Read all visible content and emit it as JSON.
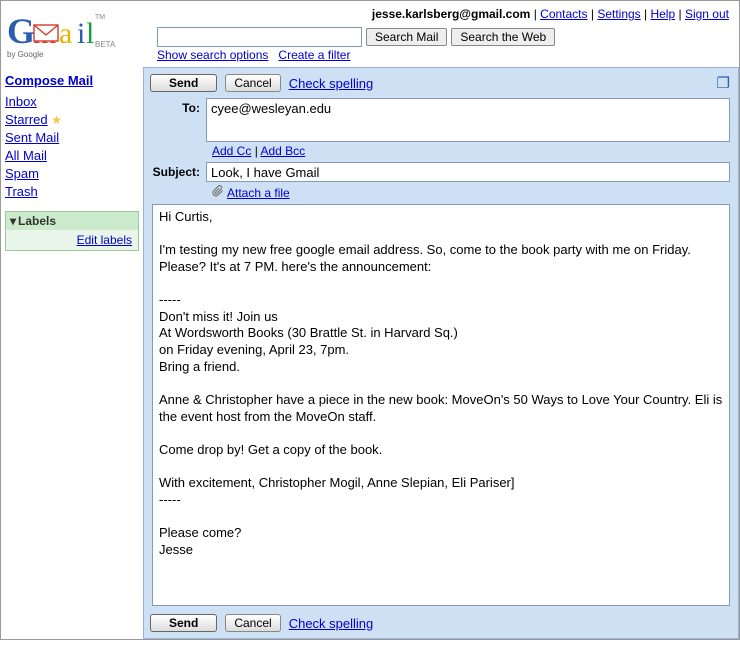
{
  "account": {
    "email": "jesse.karlsberg@gmail.com",
    "links": {
      "contacts": "Contacts",
      "settings": "Settings",
      "help": "Help",
      "signout": "Sign out"
    }
  },
  "search": {
    "value": "",
    "search_mail_label": "Search Mail",
    "search_web_label": "Search the Web",
    "show_options": "Show search options",
    "create_filter": "Create a filter"
  },
  "sidebar": {
    "compose": "Compose Mail",
    "items": [
      {
        "label": "Inbox"
      },
      {
        "label": "Starred"
      },
      {
        "label": "Sent Mail"
      },
      {
        "label": "All Mail"
      },
      {
        "label": "Spam"
      },
      {
        "label": "Trash"
      }
    ],
    "labels_header": "Labels",
    "edit_labels": "Edit labels"
  },
  "compose": {
    "send_label": "Send",
    "cancel_label": "Cancel",
    "check_spelling": "Check spelling",
    "to_label": "To:",
    "to_value": "cyee@wesleyan.edu",
    "add_cc": "Add Cc",
    "add_bcc": "Add Bcc",
    "subject_label": "Subject:",
    "subject_value": "Look, I have Gmail",
    "attach_label": "Attach a file",
    "body": "Hi Curtis,\n\nI'm testing my new free google email address. So, come to the book party with me on Friday. Please? It's at 7 PM. here's the announcement:\n\n-----\nDon't miss it! Join us\nAt Wordsworth Books (30 Brattle St. in Harvard Sq.)\non Friday evening, April 23, 7pm.\nBring a friend.\n\nAnne & Christopher have a piece in the new book: MoveOn's 50 Ways to Love Your Country. Eli is the event host from the MoveOn staff.\n\nCome drop by! Get a copy of the book.\n\nWith excitement, Christopher Mogil, Anne Slepian, Eli Pariser]\n-----\n\nPlease come?\nJesse"
  }
}
